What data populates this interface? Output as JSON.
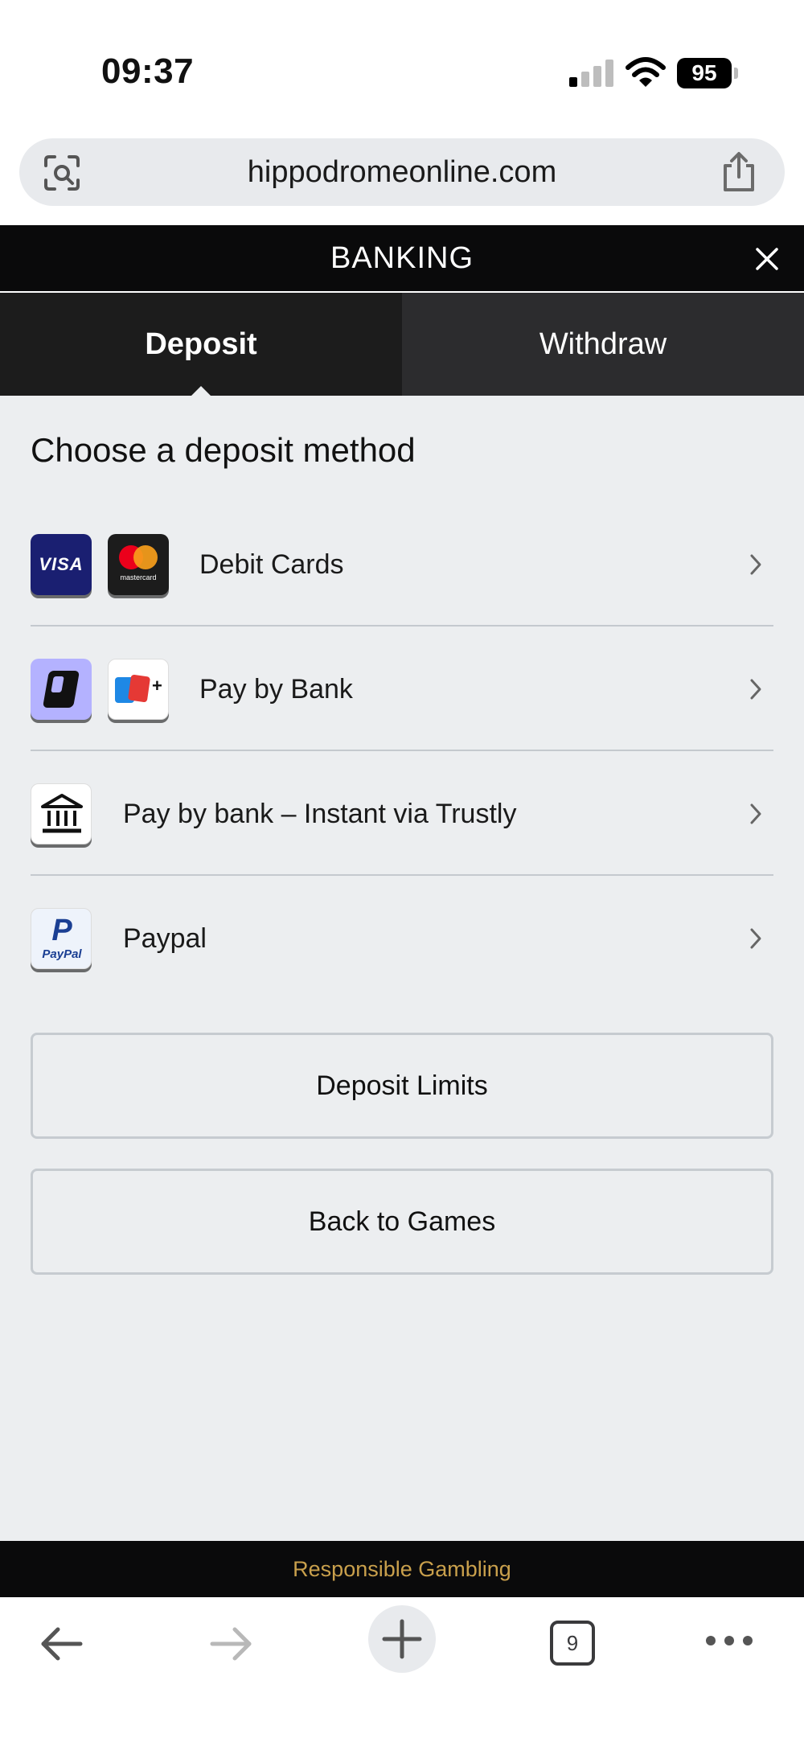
{
  "status_bar": {
    "time": "09:37",
    "battery": "95"
  },
  "browser": {
    "url": "hippodromeonline.com",
    "tab_count": "9"
  },
  "header": {
    "title": "BANKING"
  },
  "tabs": [
    {
      "label": "Deposit",
      "active": true
    },
    {
      "label": "Withdraw",
      "active": false
    }
  ],
  "main": {
    "title": "Choose a deposit method",
    "methods": [
      {
        "label": "Debit Cards",
        "icons": [
          "visa-logo",
          "mastercard-logo"
        ]
      },
      {
        "label": "Pay by Bank",
        "icons": [
          "pay-by-bank-logo",
          "bank-cards-logo"
        ]
      },
      {
        "label": "Pay by bank – Instant via Trustly",
        "icons": [
          "bank-building-icon"
        ]
      },
      {
        "label": "Paypal",
        "icons": [
          "paypal-logo"
        ]
      }
    ],
    "logo_text": {
      "visa": "VISA",
      "mastercard": "mastercard",
      "paypal_mark": "P",
      "paypal": "PayPal"
    }
  },
  "buttons": {
    "deposit_limits": "Deposit Limits",
    "back_to_games": "Back to Games"
  },
  "footer": {
    "responsible_gambling": "Responsible Gambling"
  },
  "colors": {
    "header_bg": "#0a0a0b",
    "content_bg": "#eceef0",
    "footer_text": "#c9a04c",
    "tab_active": "#1c1c1c",
    "tab_inactive": "#2c2c2e"
  }
}
